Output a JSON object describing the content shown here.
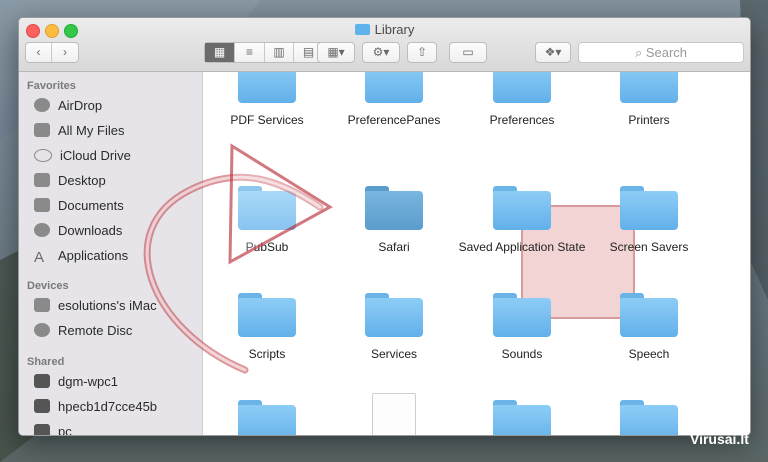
{
  "window": {
    "title": "Library"
  },
  "toolbar": {
    "back_label": "‹",
    "forward_label": "›",
    "action_label": "⚙",
    "search_placeholder": "Search"
  },
  "sidebar": {
    "favorites_title": "Favorites",
    "favorites": [
      {
        "label": "AirDrop",
        "icon": "airdrop-icon"
      },
      {
        "label": "All My Files",
        "icon": "all-files-icon"
      },
      {
        "label": "iCloud Drive",
        "icon": "cloud-icon"
      },
      {
        "label": "Desktop",
        "icon": "desktop-icon"
      },
      {
        "label": "Documents",
        "icon": "documents-icon"
      },
      {
        "label": "Downloads",
        "icon": "downloads-icon"
      },
      {
        "label": "Applications",
        "icon": "applications-icon"
      }
    ],
    "devices_title": "Devices",
    "devices": [
      {
        "label": "esolutions's iMac",
        "icon": "imac-icon"
      },
      {
        "label": "Remote Disc",
        "icon": "disc-icon"
      }
    ],
    "shared_title": "Shared",
    "shared": [
      {
        "label": "dgm-wpc1",
        "icon": "computer-icon"
      },
      {
        "label": "hpecb1d7cce45b",
        "icon": "computer-icon"
      },
      {
        "label": "pc",
        "icon": "computer-icon"
      }
    ]
  },
  "content": {
    "items": [
      {
        "label": "PDF Services",
        "type": "folder"
      },
      {
        "label": "PreferencePanes",
        "type": "folder"
      },
      {
        "label": "Preferences",
        "type": "folder"
      },
      {
        "label": "Printers",
        "type": "folder"
      },
      {
        "label": "PubSub",
        "type": "folder"
      },
      {
        "label": "Safari",
        "type": "folder",
        "selected": true
      },
      {
        "label": "Saved Application State",
        "type": "folder"
      },
      {
        "label": "Screen Savers",
        "type": "folder"
      },
      {
        "label": "Scripts",
        "type": "folder"
      },
      {
        "label": "Services",
        "type": "folder"
      },
      {
        "label": "Sounds",
        "type": "folder"
      },
      {
        "label": "Speech",
        "type": "folder"
      },
      {
        "label": "",
        "type": "folder"
      },
      {
        "label": "",
        "type": "document"
      },
      {
        "label": "",
        "type": "folder"
      },
      {
        "label": "",
        "type": "folder"
      }
    ]
  },
  "watermark": "Virusai.lt",
  "colors": {
    "folder": "#62b0ea",
    "selection": "#e8b0b0",
    "arrow": "#c0404a"
  }
}
